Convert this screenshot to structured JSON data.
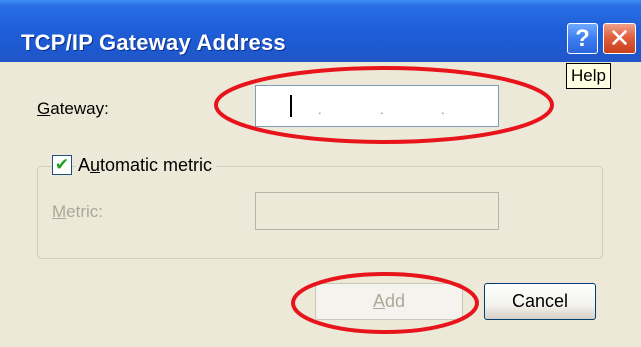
{
  "dialog": {
    "title": "TCP/IP Gateway Address",
    "help_button_glyph": "?",
    "close_button_glyph": "✕",
    "help_tooltip": "Help"
  },
  "gateway": {
    "label_accel": "G",
    "label_rest": "ateway:",
    "value": "",
    "separators": [
      ".",
      ".",
      "."
    ]
  },
  "automatic_metric": {
    "checked": true,
    "check_glyph": "✔",
    "label_before": "A",
    "label_accel": "u",
    "label_after": "tomatic metric"
  },
  "metric": {
    "label_accel": "M",
    "label_rest": "etric:",
    "value": "",
    "enabled": false
  },
  "buttons": {
    "add_accel": "A",
    "add_rest": "dd",
    "add_enabled": false,
    "cancel": "Cancel"
  },
  "annotations": {
    "stroke_color": "#e8141c",
    "targets": [
      "gateway-ip-field",
      "add-button"
    ]
  },
  "colors": {
    "titlebar": "#1f5fd9",
    "dialog_bg": "#ece9d8",
    "disabled_text": "#aca899",
    "checkmark": "#21a121"
  }
}
